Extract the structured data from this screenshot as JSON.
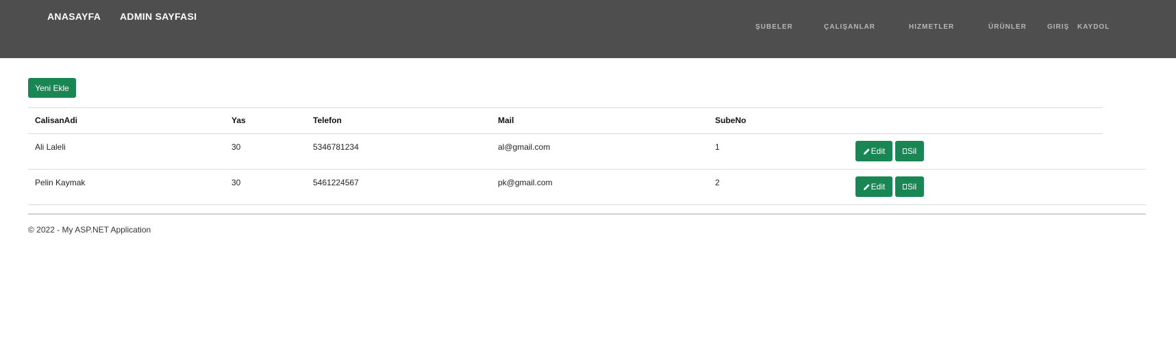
{
  "nav": {
    "left": [
      {
        "label": "ANASAYFA"
      },
      {
        "label": "ADMIN SAYFASI"
      }
    ],
    "right": [
      {
        "label": "ŞUBELER"
      },
      {
        "label": "ÇALIŞANLAR"
      },
      {
        "label": "HIZMETLER"
      },
      {
        "label": "ÜRÜNLER"
      },
      {
        "label": "GIRIŞ"
      },
      {
        "label": "KAYDOL"
      }
    ]
  },
  "main": {
    "add_button": "Yeni Ekle"
  },
  "table": {
    "columns": [
      "CalisanAdi",
      "Yas",
      "Telefon",
      "Mail",
      "SubeNo"
    ],
    "rows": [
      {
        "name": "Ali Laleli",
        "age": "30",
        "phone": "5346781234",
        "mail": "al@gmail.com",
        "branch": "1",
        "edit": "Edit",
        "delete": "Sil"
      },
      {
        "name": "Pelin Kaymak",
        "age": "30",
        "phone": "5461224567",
        "mail": "pk@gmail.com",
        "branch": "2",
        "edit": "Edit",
        "delete": "Sil"
      }
    ]
  },
  "footer": {
    "text": "© 2022 - My ASP.NET Application"
  },
  "colors": {
    "navbar": "#4e4e4e",
    "accent_green": "#198754",
    "nav_right_text": "#b7b7b7"
  },
  "icons": {
    "edit": "pencil-icon",
    "delete": "trash-icon"
  }
}
